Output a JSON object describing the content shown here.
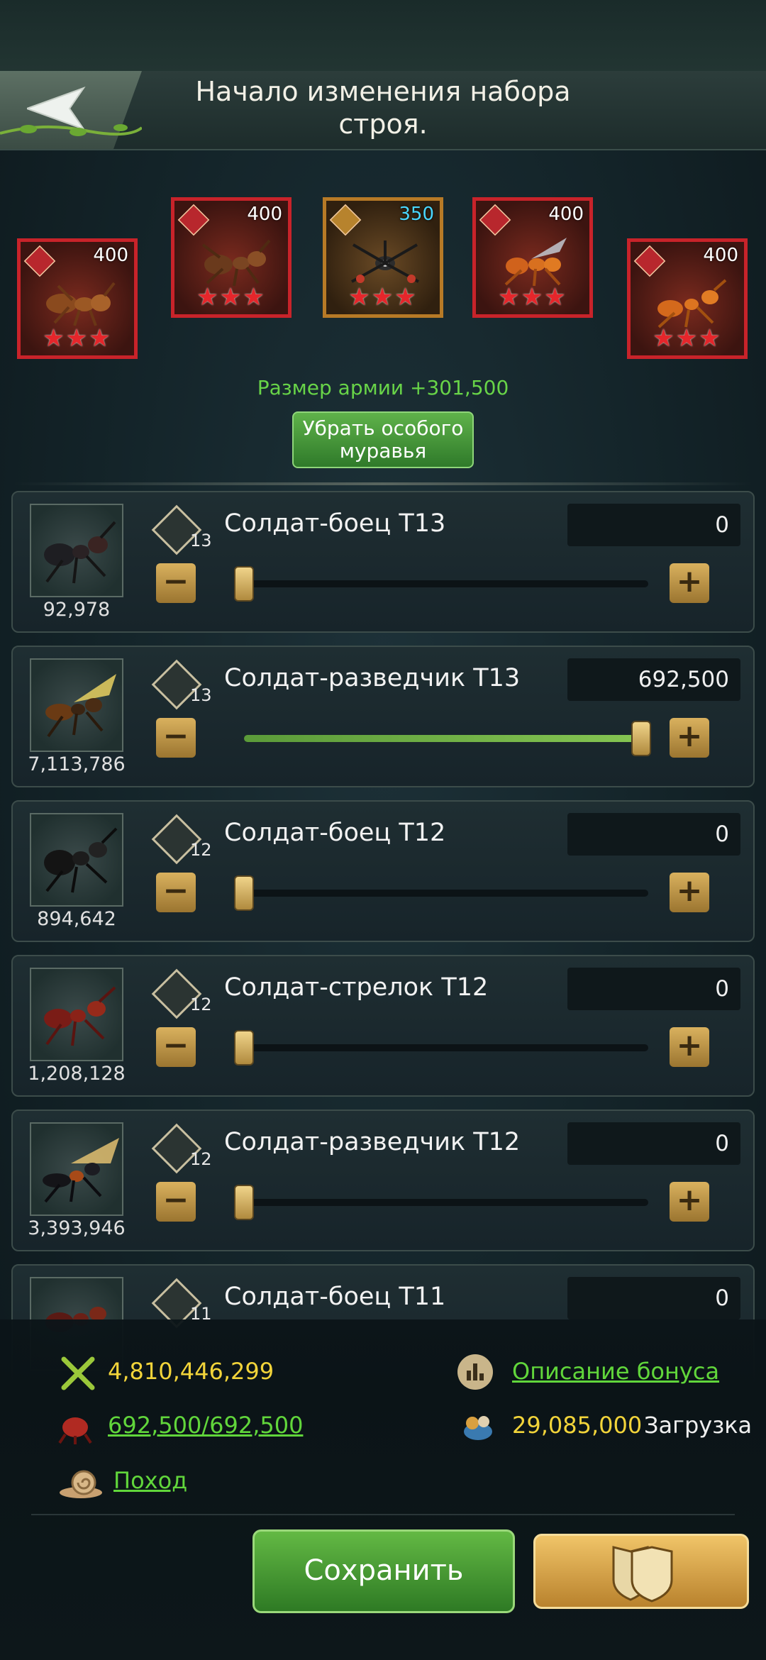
{
  "header": {
    "title": "Начало изменения набора строя.",
    "back_icon": "back-arrow-icon"
  },
  "special_ants": [
    {
      "level": "400",
      "stars": "★★★",
      "frame": "red"
    },
    {
      "level": "400",
      "stars": "★★★",
      "frame": "red"
    },
    {
      "level": "350",
      "stars": "★★★",
      "frame": "gold"
    },
    {
      "level": "400",
      "stars": "★★★",
      "frame": "red"
    },
    {
      "level": "400",
      "stars": "★★★",
      "frame": "red"
    }
  ],
  "army_size": "Размер армии +301,500",
  "remove_special_button": "Убрать особого муравья",
  "troops": [
    {
      "name": "Солдат-боец T13",
      "tier": "13",
      "available": "92,978",
      "quantity": "0",
      "slider_fraction": 0.0
    },
    {
      "name": "Солдат-разведчик T13",
      "tier": "13",
      "available": "7,113,786",
      "quantity": "692,500",
      "slider_fraction": 1.0
    },
    {
      "name": "Солдат-боец T12",
      "tier": "12",
      "available": "894,642",
      "quantity": "0",
      "slider_fraction": 0.0
    },
    {
      "name": "Солдат-стрелок T12",
      "tier": "12",
      "available": "1,208,128",
      "quantity": "0",
      "slider_fraction": 0.0
    },
    {
      "name": "Солдат-разведчик T12",
      "tier": "12",
      "available": "3,393,946",
      "quantity": "0",
      "slider_fraction": 0.0
    },
    {
      "name": "Солдат-боец T11",
      "tier": "11",
      "available": "",
      "quantity": "0",
      "slider_fraction": 0.0
    }
  ],
  "bottom": {
    "power": "4,810,446,299",
    "bonus_link": "Описание бонуса",
    "troops_count": "692,500/692,500",
    "load_value": "29,085,000",
    "load_label": "Загрузка",
    "march_link": "Поход",
    "save_button": "Сохранить"
  },
  "colors": {
    "accent_green": "#61d63b",
    "gold": "#f2d43a",
    "button_gold": "#d9b15e"
  }
}
